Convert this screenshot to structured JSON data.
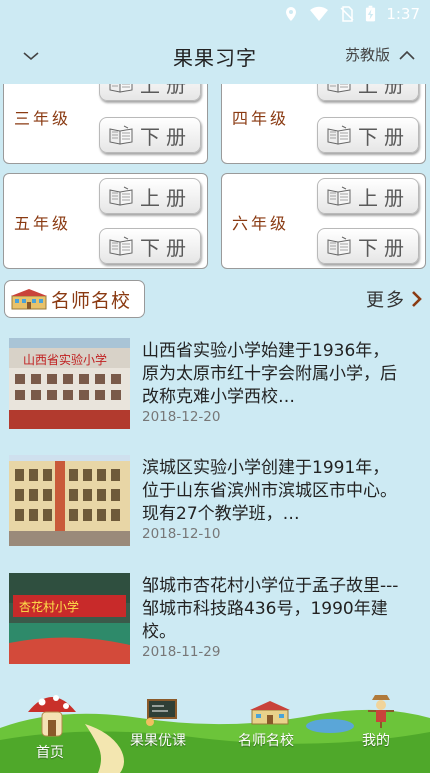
{
  "status_bar": {
    "time": "1:37",
    "icons": [
      "location-icon",
      "wifi-icon",
      "no-sim-icon",
      "battery-charging-icon"
    ]
  },
  "header": {
    "title": "果果习字",
    "edition": "苏教版",
    "left_icon": "chevron-down-icon",
    "right_icon": "chevron-up-icon"
  },
  "grades": [
    {
      "label": "三年级",
      "upper": "上册",
      "lower": "下册"
    },
    {
      "label": "四年级",
      "upper": "上册",
      "lower": "下册"
    },
    {
      "label": "五年级",
      "upper": "上册",
      "lower": "下册"
    },
    {
      "label": "六年级",
      "upper": "上册",
      "lower": "下册"
    }
  ],
  "famous_schools": {
    "tag_label": "名师名校",
    "more_label": "更多"
  },
  "news": [
    {
      "text": "山西省实验小学始建于1936年，原为太原市红十字会附属小学，后改称克难小学西校…",
      "date": "2018-12-20",
      "thumb_caption": "山西省实验小学"
    },
    {
      "text": "滨城区实验小学创建于1991年，位于山东省滨州市滨城区市中心。现有27个教学班，…",
      "date": "2018-12-10",
      "thumb_caption": ""
    },
    {
      "text": "邹城市杏花村小学位于孟子故里---邹城市科技路436号，1990年建校。",
      "date": "2018-11-29",
      "thumb_caption": "杏花村小学"
    }
  ],
  "tabbar": {
    "tabs": [
      {
        "label": "首页",
        "icon": "mushroom-house-icon"
      },
      {
        "label": "果果优课",
        "icon": "blackboard-icon"
      },
      {
        "label": "名师名校",
        "icon": "school-building-icon"
      },
      {
        "label": "我的",
        "icon": "scarecrow-icon"
      }
    ]
  },
  "colors": {
    "background": "#cdeaf3",
    "grade_text": "#8a3a12",
    "grass": "#5bb52a"
  }
}
